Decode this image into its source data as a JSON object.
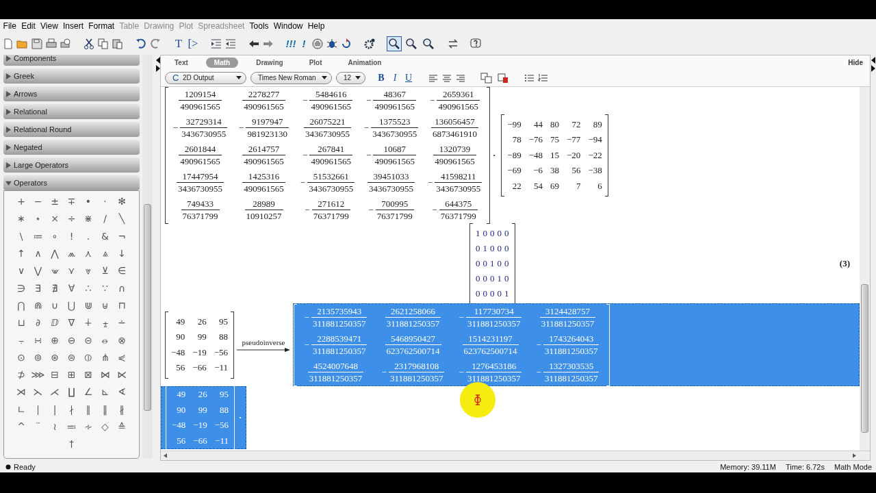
{
  "menu": [
    {
      "label": "File",
      "disabled": false
    },
    {
      "label": "Edit",
      "disabled": false
    },
    {
      "label": "View",
      "disabled": false
    },
    {
      "label": "Insert",
      "disabled": false
    },
    {
      "label": "Format",
      "disabled": false
    },
    {
      "label": "Table",
      "disabled": true
    },
    {
      "label": "Drawing",
      "disabled": true
    },
    {
      "label": "Plot",
      "disabled": true
    },
    {
      "label": "Spreadsheet",
      "disabled": true
    },
    {
      "label": "Tools",
      "disabled": false
    },
    {
      "label": "Window",
      "disabled": false
    },
    {
      "label": "Help",
      "disabled": false
    }
  ],
  "toolbar": {
    "text_tools": [
      "T",
      "[>"
    ],
    "execute_tools": [
      "!!!",
      "!"
    ],
    "zoom_buttons": [
      {
        "selected": true
      },
      {
        "selected": false
      },
      {
        "selected": false
      }
    ]
  },
  "palettes": [
    {
      "label": "Components",
      "expanded": false
    },
    {
      "label": "Greek",
      "expanded": false
    },
    {
      "label": "Arrows",
      "expanded": false
    },
    {
      "label": "Relational",
      "expanded": false
    },
    {
      "label": "Relational Round",
      "expanded": false
    },
    {
      "label": "Negated",
      "expanded": false
    },
    {
      "label": "Large Operators",
      "expanded": false
    },
    {
      "label": "Operators",
      "expanded": true,
      "symbols": [
        "+",
        "−",
        "±",
        "∓",
        "•",
        "·",
        "✻",
        "∗",
        "⋆",
        "×",
        "÷",
        "⋇",
        "/",
        "╲",
        "\\",
        "≔",
        "∘",
        "!",
        ".",
        "&",
        "¬",
        "↑",
        "∧",
        "⋀",
        "⩕",
        "⋏",
        "⩓",
        "↓",
        "∨",
        "⋁",
        "⩖",
        "⋎",
        "⩔",
        "⊻",
        "∈",
        "∋",
        "∃",
        "∄",
        "∀",
        "∴",
        "∵",
        "∩",
        "⋂",
        "⋒",
        "∪",
        "⋃",
        "⋓",
        "⊎",
        "⊓",
        "⊔",
        "∂",
        "ⅅ",
        "∇",
        "∔",
        "⨦",
        "∸",
        "⨪",
        "∺",
        "⊕",
        "⊖",
        "⊝",
        "⦵",
        "⊗",
        "⊙",
        "⊚",
        "⊛",
        "⊜",
        "⦶",
        "⋔",
        "⋞",
        "⊅",
        "⋙",
        "⊟",
        "⊞",
        "⊠",
        "⋈",
        "⋉",
        "⋊",
        "⋋",
        "⋌",
        "∐",
        "∠",
        "⊾",
        "∢",
        "∟",
        "∣",
        "|",
        "∤",
        "∥",
        "‖",
        "∦",
        "^",
        "¨",
        "≀",
        "≕",
        "∻",
        "◇",
        "≙",
        "†"
      ]
    }
  ],
  "context_tabs": [
    {
      "label": "Text",
      "selected": false
    },
    {
      "label": "Math",
      "selected": true
    },
    {
      "label": "Drawing",
      "selected": false
    },
    {
      "label": "Plot",
      "selected": false
    },
    {
      "label": "Animation",
      "selected": false
    }
  ],
  "hide_button": "Hide",
  "format_bar": {
    "style_icon": "C",
    "style": "2D Output",
    "font": "Times New Roman",
    "size": "12",
    "bold": "B",
    "italic": "I",
    "underline": "U"
  },
  "document": {
    "product": {
      "left": {
        "rows": [
          [
            {
              "numerator": "1209154",
              "denominator": "490961565"
            },
            {
              "numerator": "2278277",
              "denominator": "490961565"
            },
            {
              "sign": "−",
              "numerator": "5484616",
              "denominator": "490961565"
            },
            {
              "sign": "−",
              "numerator": "48367",
              "denominator": "490961565"
            },
            {
              "sign": "−",
              "numerator": "2659361",
              "denominator": "490961565"
            }
          ],
          [
            {
              "sign": "−",
              "numerator": "32729314",
              "denominator": "3436730955"
            },
            {
              "sign": "−",
              "numerator": "9197947",
              "denominator": "981923130"
            },
            {
              "numerator": "26075221",
              "denominator": "3436730955"
            },
            {
              "sign": "−",
              "numerator": "1375523",
              "denominator": "3436730955"
            },
            {
              "numerator": "136056457",
              "denominator": "6873461910"
            }
          ],
          [
            {
              "numerator": "2601844",
              "denominator": "490961565"
            },
            {
              "numerator": "2614757",
              "denominator": "490961565"
            },
            {
              "sign": "−",
              "numerator": "267841",
              "denominator": "490961565"
            },
            {
              "sign": "−",
              "numerator": "10687",
              "denominator": "490961565"
            },
            {
              "numerator": "1320739",
              "denominator": "490961565"
            }
          ],
          [
            {
              "numerator": "17447954",
              "denominator": "3436730955"
            },
            {
              "numerator": "1425316",
              "denominator": "490961565"
            },
            {
              "sign": "−",
              "numerator": "51532661",
              "denominator": "3436730955"
            },
            {
              "numerator": "39451033",
              "denominator": "3436730955"
            },
            {
              "sign": "−",
              "numerator": "41598211",
              "denominator": "3436730955"
            }
          ],
          [
            {
              "numerator": "749433",
              "denominator": "76371799"
            },
            {
              "numerator": "28989",
              "denominator": "10910257"
            },
            {
              "sign": "−",
              "numerator": "271612",
              "denominator": "76371799"
            },
            {
              "sign": "−",
              "numerator": "700995",
              "denominator": "76371799"
            },
            {
              "sign": "−",
              "numerator": "644375",
              "denominator": "76371799"
            }
          ]
        ]
      },
      "operator": "·",
      "right": {
        "rows": [
          [
            "−99",
            "44",
            "80",
            "72",
            "89"
          ],
          [
            "78",
            "−76",
            "75",
            "−77",
            "−94"
          ],
          [
            "−89",
            "−48",
            "15",
            "−20",
            "−22"
          ],
          [
            "−69",
            "−6",
            "38",
            "56",
            "−38"
          ],
          [
            "22",
            "54",
            "69",
            "7",
            "6"
          ]
        ]
      }
    },
    "identity": {
      "rows": [
        [
          "1",
          "0",
          "0",
          "0",
          "0"
        ],
        [
          "0",
          "1",
          "0",
          "0",
          "0"
        ],
        [
          "0",
          "0",
          "1",
          "0",
          "0"
        ],
        [
          "0",
          "0",
          "0",
          "1",
          "0"
        ],
        [
          "0",
          "0",
          "0",
          "0",
          "1"
        ]
      ]
    },
    "equation_label": "(3)",
    "pseudoinverse": {
      "input": {
        "rows": [
          [
            "49",
            "26",
            "95"
          ],
          [
            "90",
            "99",
            "88"
          ],
          [
            "−48",
            "−19",
            "−56"
          ],
          [
            "56",
            "−66",
            "−11"
          ]
        ]
      },
      "arrow_label": "pseudoinverse",
      "result": {
        "selected": true,
        "rows": [
          [
            {
              "sign": "−",
              "numerator": "2135735943",
              "denominator": "311881250357"
            },
            {
              "numerator": "2621258066",
              "denominator": "311881250357"
            },
            {
              "sign": "−",
              "numerator": "117730734",
              "denominator": "311881250357"
            },
            {
              "numerator": "3124428757",
              "denominator": "311881250357"
            }
          ],
          [
            {
              "sign": "−",
              "numerator": "2288539471",
              "denominator": "311881250357"
            },
            {
              "numerator": "5468950427",
              "denominator": "623762500714"
            },
            {
              "numerator": "1514231197",
              "denominator": "623762500714"
            },
            {
              "sign": "−",
              "numerator": "1743264043",
              "denominator": "311881250357"
            }
          ],
          [
            {
              "numerator": "4524007648",
              "denominator": "311881250357"
            },
            {
              "sign": "−",
              "numerator": "2317968108",
              "denominator": "311881250357"
            },
            {
              "sign": "−",
              "numerator": "1276453186",
              "denominator": "311881250357"
            },
            {
              "sign": "−",
              "numerator": "1327303535",
              "denominator": "311881250357"
            }
          ]
        ]
      }
    },
    "selected_input": {
      "selected": true,
      "rows": [
        [
          "49",
          "26",
          "95"
        ],
        [
          "90",
          "99",
          "88"
        ],
        [
          "−48",
          "−19",
          "−56"
        ],
        [
          "56",
          "−66",
          "−11"
        ]
      ],
      "operator": "·"
    }
  },
  "status_bar": {
    "state": "Ready",
    "memory": "Memory: 39.11M",
    "time": "Time: 6.72s",
    "mode": "Math Mode"
  }
}
